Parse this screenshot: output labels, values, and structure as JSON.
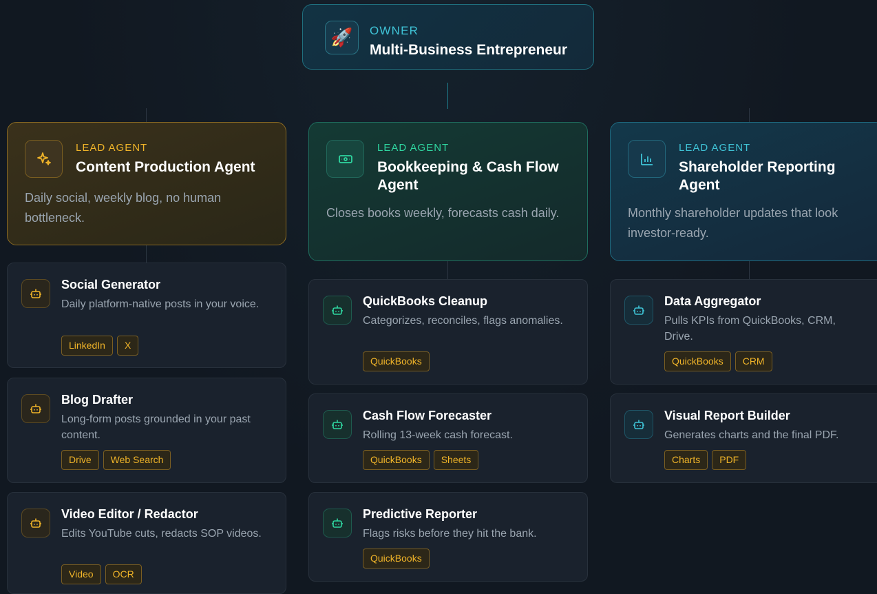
{
  "owner": {
    "icon": "rocket-icon",
    "glyph": "🚀",
    "eyebrow": "OWNER",
    "title": "Multi-Business Entrepreneur"
  },
  "columns": [
    {
      "accent": "#f0b429",
      "lead": {
        "icon": "sparkles-icon",
        "eyebrow": "LEAD AGENT",
        "title": "Content Production Agent",
        "desc": "Daily social, weekly blog, no human bottleneck."
      },
      "agents": [
        {
          "title": "Social Generator",
          "desc": "Daily platform-native posts in your voice.",
          "tags": [
            "LinkedIn",
            "X"
          ]
        },
        {
          "title": "Blog Drafter",
          "desc": "Long-form posts grounded in your past content.",
          "tags": [
            "Drive",
            "Web Search"
          ]
        },
        {
          "title": "Video Editor / Redactor",
          "desc": "Edits YouTube cuts, redacts SOP videos.",
          "tags": [
            "Video",
            "OCR"
          ]
        }
      ]
    },
    {
      "accent": "#2fd6a0",
      "lead": {
        "icon": "banknote-icon",
        "eyebrow": "LEAD AGENT",
        "title": "Bookkeeping & Cash Flow Agent",
        "desc": "Closes books weekly, forecasts cash daily."
      },
      "agents": [
        {
          "title": "QuickBooks Cleanup",
          "desc": "Categorizes, reconciles, flags anomalies.",
          "tags": [
            "QuickBooks"
          ]
        },
        {
          "title": "Cash Flow Forecaster",
          "desc": "Rolling 13-week cash forecast.",
          "tags": [
            "QuickBooks",
            "Sheets"
          ]
        },
        {
          "title": "Predictive Reporter",
          "desc": "Flags risks before they hit the bank.",
          "tags": [
            "QuickBooks"
          ]
        }
      ]
    },
    {
      "accent": "#3fc3d6",
      "lead": {
        "icon": "bar-chart-icon",
        "eyebrow": "LEAD AGENT",
        "title": "Shareholder Reporting Agent",
        "desc": "Monthly shareholder updates that look investor-ready."
      },
      "agents": [
        {
          "title": "Data Aggregator",
          "desc": "Pulls KPIs from QuickBooks, CRM, Drive.",
          "tags": [
            "QuickBooks",
            "CRM"
          ]
        },
        {
          "title": "Visual Report Builder",
          "desc": "Generates charts and the final PDF.",
          "tags": [
            "Charts",
            "PDF"
          ]
        }
      ]
    }
  ]
}
